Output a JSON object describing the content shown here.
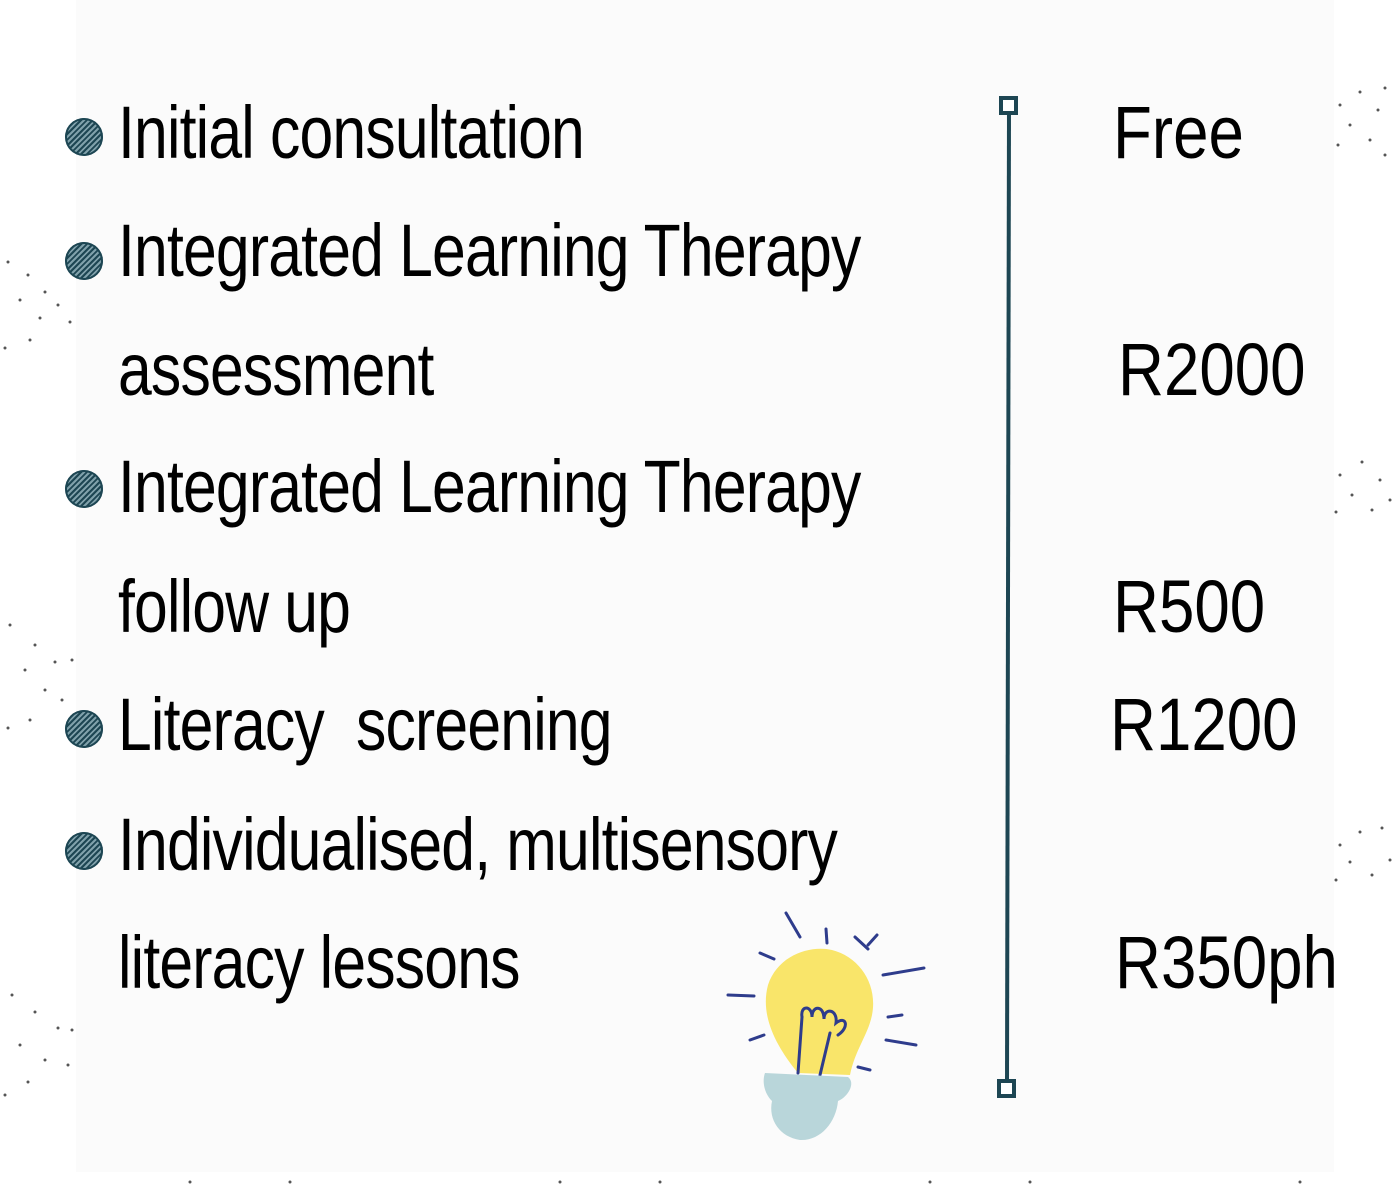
{
  "services": [
    {
      "lines": [
        "Initial consultation"
      ],
      "price": "Free"
    },
    {
      "lines": [
        "Integrated Learning Therapy",
        "assessment"
      ],
      "price": "R2000"
    },
    {
      "lines": [
        "Integrated Learning Therapy",
        "follow up"
      ],
      "price": "R500"
    },
    {
      "lines": [
        "Literacy  screening"
      ],
      "price": "R1200"
    },
    {
      "lines": [
        "Individualised, multisensory",
        "literacy lessons"
      ],
      "price": "R350ph"
    }
  ],
  "colors": {
    "accent": "#1d4653",
    "bulb": "#f9e56a",
    "bulb_base": "#b9d6da",
    "bulb_rays": "#2e3c8c"
  },
  "icons": {
    "bullet": "hatched-circle-icon",
    "divider": "vertical-line-icon",
    "illustration": "lightbulb-icon"
  }
}
